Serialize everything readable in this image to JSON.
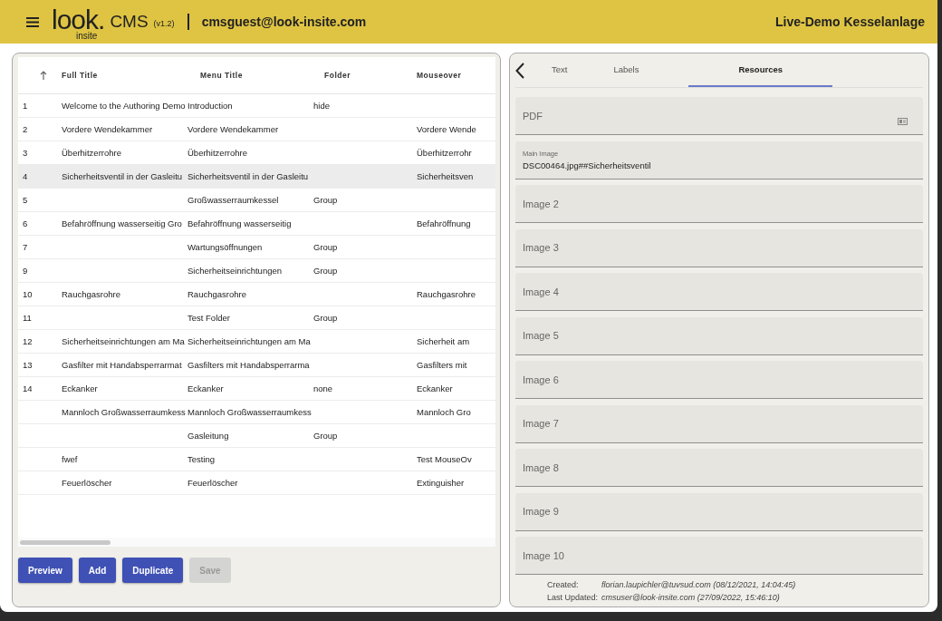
{
  "header": {
    "logo": "look.",
    "logo_sub": "insite",
    "app_name": "CMS",
    "version": "(v1.2)",
    "user": "cmsguest@look-insite.com",
    "project": "Live-Demo Kesselanlage"
  },
  "table": {
    "columns": [
      "Full Title",
      "Menu Title",
      "Folder",
      "Mouseover"
    ],
    "rows": [
      {
        "num": "1",
        "full_title": "Welcome to the Authoring Demo",
        "menu_title": "Introduction",
        "folder": "hide",
        "mouseover": "",
        "selected": false
      },
      {
        "num": "2",
        "full_title": "Vordere Wendekammer",
        "menu_title": "Vordere Wendekammer",
        "folder": "",
        "mouseover": "Vordere Wende",
        "selected": false
      },
      {
        "num": "3",
        "full_title": "Überhitzerrohre",
        "menu_title": "Überhitzerrohre",
        "folder": "",
        "mouseover": "Überhitzerrohr",
        "selected": false
      },
      {
        "num": "4",
        "full_title": "Sicherheitsventil in der Gasleitu",
        "menu_title": "Sicherheitsventil in der Gasleitu",
        "folder": "",
        "mouseover": "Sicherheitsven",
        "selected": true
      },
      {
        "num": "5",
        "full_title": "",
        "menu_title": "Großwasserraumkessel",
        "folder": "Group",
        "mouseover": "",
        "selected": false
      },
      {
        "num": "6",
        "full_title": "Befahröffnung wasserseitig Gro",
        "menu_title": "Befahröffnung wasserseitig",
        "folder": "",
        "mouseover": "Befahröffnung",
        "selected": false
      },
      {
        "num": "7",
        "full_title": "",
        "menu_title": "Wartungsöffnungen",
        "folder": "Group",
        "mouseover": "",
        "selected": false
      },
      {
        "num": "9",
        "full_title": "",
        "menu_title": "Sicherheitseinrichtungen",
        "folder": "Group",
        "mouseover": "",
        "selected": false
      },
      {
        "num": "10",
        "full_title": "Rauchgasrohre",
        "menu_title": "Rauchgasrohre",
        "folder": "",
        "mouseover": "Rauchgasrohre",
        "selected": false
      },
      {
        "num": "11",
        "full_title": "",
        "menu_title": "Test Folder",
        "folder": "Group",
        "mouseover": "",
        "selected": false
      },
      {
        "num": "12",
        "full_title": "Sicherheitseinrichtungen am Ma",
        "menu_title": "Sicherheitseinrichtungen am Ma",
        "folder": "",
        "mouseover": "Sicherheit am",
        "selected": false
      },
      {
        "num": "13",
        "full_title": "Gasfilter mit Handabsperrarmat",
        "menu_title": "Gasfilters mit Handabsperrarma",
        "folder": "",
        "mouseover": "Gasfilters mit",
        "selected": false
      },
      {
        "num": "14",
        "full_title": "Eckanker",
        "menu_title": "Eckanker",
        "folder": "none",
        "mouseover": "Eckanker",
        "selected": false
      },
      {
        "num": "",
        "full_title": "Mannloch Großwasserraumkess",
        "menu_title": "Mannloch Großwasserraumkess",
        "folder": "",
        "mouseover": "Mannloch Gro",
        "selected": false
      },
      {
        "num": "",
        "full_title": "",
        "menu_title": "Gasleitung",
        "folder": "Group",
        "mouseover": "",
        "selected": false
      },
      {
        "num": "",
        "full_title": "fwef",
        "menu_title": "Testing",
        "folder": "",
        "mouseover": "Test MouseOv",
        "selected": false
      },
      {
        "num": "",
        "full_title": "Feuerlöscher",
        "menu_title": "Feuerlöscher",
        "folder": "",
        "mouseover": "Extinguisher",
        "selected": false
      }
    ]
  },
  "buttons": [
    {
      "label": "Preview",
      "disabled": false
    },
    {
      "label": "Add",
      "disabled": false
    },
    {
      "label": "Duplicate",
      "disabled": false
    },
    {
      "label": "Save",
      "disabled": true
    }
  ],
  "tabs": [
    {
      "label": "Text",
      "selected": false
    },
    {
      "label": "Labels",
      "selected": false
    },
    {
      "label": "Resources",
      "selected": true
    }
  ],
  "fields": [
    {
      "kind": "file",
      "placeholder": "PDF"
    },
    {
      "kind": "text",
      "label": "Main Image",
      "value": "DSC00464.jpg##Sicherheitsventil"
    },
    {
      "kind": "text",
      "placeholder": "Image 2"
    },
    {
      "kind": "text",
      "placeholder": "Image 3"
    },
    {
      "kind": "text",
      "placeholder": "Image 4"
    },
    {
      "kind": "text",
      "placeholder": "Image 5"
    },
    {
      "kind": "text",
      "placeholder": "Image 6"
    },
    {
      "kind": "text",
      "placeholder": "Image 7"
    },
    {
      "kind": "text",
      "placeholder": "Image 8"
    },
    {
      "kind": "text",
      "placeholder": "Image 9"
    },
    {
      "kind": "text",
      "placeholder": "Image 10"
    }
  ],
  "footer": [
    {
      "label": "Created:",
      "value": "florian.laupichler@tuvsud.com (08/12/2021, 14:04:45)"
    },
    {
      "label": "Last Updated:",
      "value": "cmsuser@look-insite.com (27/09/2022, 15:46:10)"
    }
  ]
}
